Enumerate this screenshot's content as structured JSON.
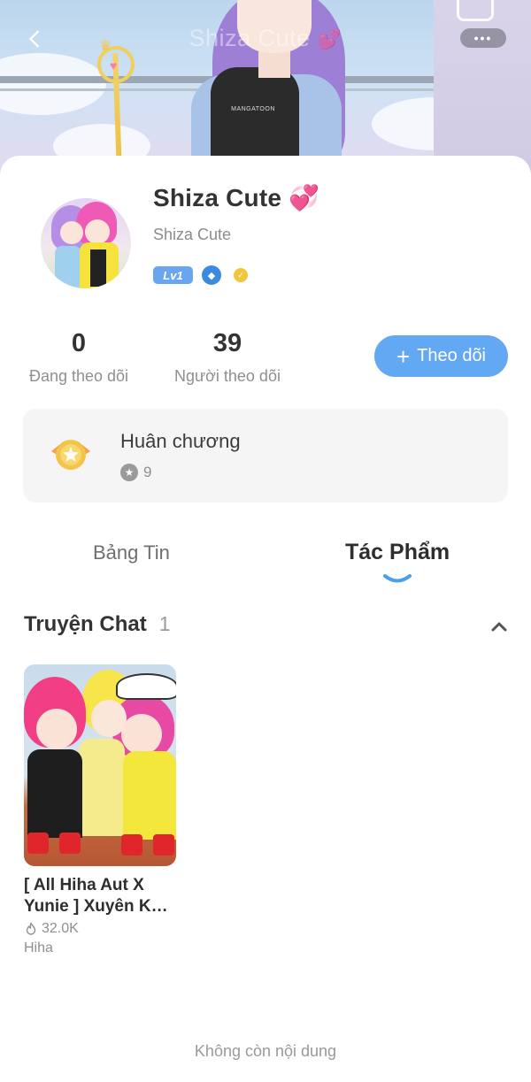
{
  "header": {
    "title": "Shiza Cute",
    "more_label": "•••",
    "banner_shirt_text": "MANGATOON"
  },
  "profile": {
    "name": "Shiza Cute",
    "name_emoji": "💞",
    "username": "Shiza Cute",
    "level_badge": "Lv1"
  },
  "stats": [
    {
      "value": "0",
      "label": "Đang theo dõi"
    },
    {
      "value": "39",
      "label": "Người theo dõi"
    }
  ],
  "follow_button": {
    "icon": "+",
    "label": "Theo dõi"
  },
  "medals": {
    "title": "Huân chương",
    "count": "9"
  },
  "tabs": [
    {
      "label": "Bảng Tin",
      "active": false
    },
    {
      "label": "Tác Phẩm",
      "active": true
    }
  ],
  "section": {
    "title": "Truyện Chat",
    "count": "1"
  },
  "works": [
    {
      "title": "[ All Hiha Aut X Yunie ] Xuyên K…",
      "views": "32.0K",
      "author": "Hiha"
    }
  ],
  "footer": {
    "end_text": "Không còn nội dung"
  },
  "colors": {
    "accent": "#63a8f2",
    "level_badge": "#6aa6ef",
    "text": "#333333",
    "muted": "#8f8f8f"
  }
}
